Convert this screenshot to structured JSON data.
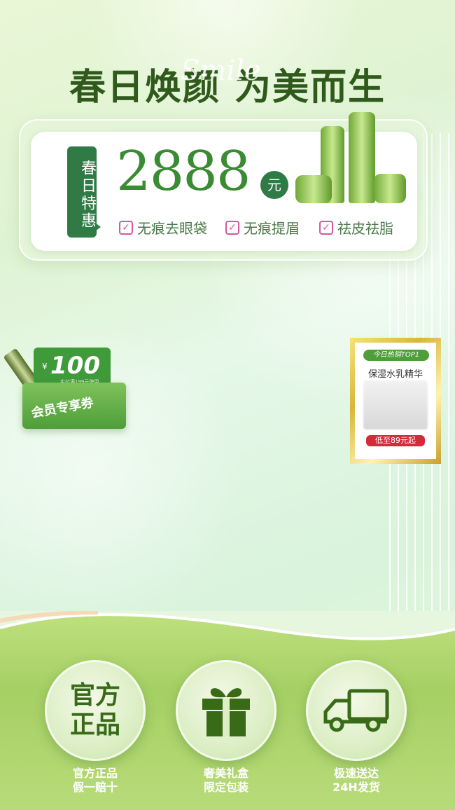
{
  "headline": "春日焕颜 为美而生",
  "script_deco": "Smile",
  "price_card": {
    "tag": "春日特惠",
    "price": "2888",
    "unit": "元",
    "features": [
      "无痕去眼袋",
      "无痕提眉",
      "祛皮祛脂"
    ]
  },
  "coupon": {
    "currency": "¥",
    "amount": "100",
    "condition": "实付满199元使用",
    "label": "会员专享券"
  },
  "hot_item": {
    "tag": "今日热销TOP1",
    "name": "保湿水乳精华",
    "price": "低至89元起"
  },
  "badges": [
    {
      "text": "官方正品",
      "caption1": "官方正品",
      "caption2": "假一赔十",
      "icon": "text-badge"
    },
    {
      "icon": "gift-icon",
      "caption1": "奢美礼盒",
      "caption2": "限定包装"
    },
    {
      "icon": "truck-icon",
      "caption1": "极速送达",
      "caption2": "24H发货"
    }
  ],
  "colors": {
    "accent_green": "#2f7a45",
    "price_green": "#3b8a34",
    "check_pink": "#d9579a",
    "hot_red": "#d42a3c"
  }
}
